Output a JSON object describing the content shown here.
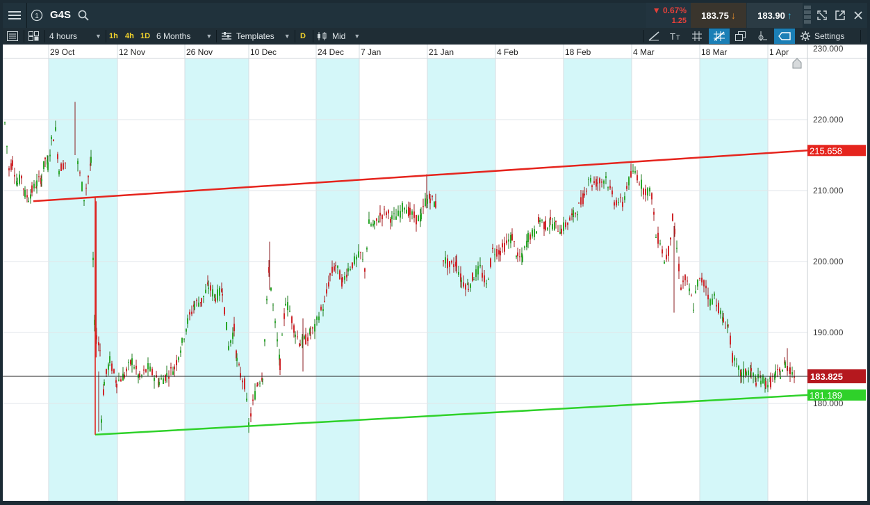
{
  "header": {
    "symbol": "G4S",
    "change_percent": "▼ 0.67%",
    "change_abs": "1.25",
    "sell_price": "183.75",
    "buy_price": "183.90",
    "icons": [
      "menu-icon",
      "info-icon",
      "search-icon",
      "chart-icon",
      "expand-icon",
      "popout-icon",
      "close-icon"
    ]
  },
  "toolbar": {
    "interval": "4 hours",
    "quick_intervals": [
      "1h",
      "4h",
      "1D"
    ],
    "range": "6 Months",
    "templates_label": "Templates",
    "d_label": "D",
    "price_type": "Mid",
    "settings_label": "Settings"
  },
  "colors": {
    "up": "#2aa82a",
    "down": "#d0262b",
    "resistance": "#e5241d",
    "support": "#2fd12a",
    "shade": "#d4f7f9",
    "price_tag": "#b5181e"
  },
  "chart_data": {
    "type": "candlestick",
    "symbol": "G4S",
    "interval": "4 hours",
    "range": "6 Months",
    "x_labels": [
      "29 Oct",
      "12 Nov",
      "26 Nov",
      "10 Dec",
      "24 Dec",
      "7 Jan",
      "21 Jan",
      "4 Feb",
      "18 Feb",
      "4 Mar",
      "18 Mar",
      "1 Apr"
    ],
    "y_ticks": [
      "230.000",
      "220.000",
      "210.000",
      "200.000",
      "190.000",
      "180.000"
    ],
    "ylim": [
      174,
      230
    ],
    "current_price": "183.825",
    "current_value": 183.825,
    "resistance_tag": "215.658",
    "resistance_line": [
      {
        "date": "22 Oct",
        "value": 208.5
      },
      {
        "date": "5 Apr",
        "value": 215.658
      }
    ],
    "support_tag": "181.189",
    "support_line": [
      {
        "date": "6 Nov",
        "value": 175.6
      },
      {
        "date": "5 Apr",
        "value": 181.189
      }
    ],
    "path": [
      [
        0,
        219.5
      ],
      [
        6,
        213
      ],
      [
        11,
        214
      ],
      [
        18,
        211
      ],
      [
        24,
        212
      ],
      [
        29,
        209.5
      ],
      [
        34,
        209
      ],
      [
        39,
        210
      ],
      [
        46,
        211
      ],
      [
        53,
        211.8
      ],
      [
        58,
        214.5
      ],
      [
        62,
        213.5
      ],
      [
        67,
        217
      ],
      [
        73,
        218.4
      ],
      [
        78,
        213
      ],
      [
        87,
        214
      ],
      [
        105,
        213.8
      ],
      [
        114,
        209
      ],
      [
        124,
        214
      ],
      [
        129,
        191
      ],
      [
        137,
        187.5
      ],
      [
        139,
        178
      ],
      [
        143,
        183
      ],
      [
        151,
        186
      ],
      [
        161,
        183
      ],
      [
        172,
        184
      ],
      [
        183,
        186
      ],
      [
        194,
        183.5
      ],
      [
        206,
        185
      ],
      [
        222,
        183
      ],
      [
        233,
        184
      ],
      [
        244,
        185
      ],
      [
        255,
        188.5
      ],
      [
        263,
        191.5
      ],
      [
        273,
        194
      ],
      [
        283,
        194.5
      ],
      [
        293,
        196.5
      ],
      [
        303,
        195
      ],
      [
        313,
        196
      ],
      [
        322,
        188
      ],
      [
        330,
        190.5
      ],
      [
        334,
        186
      ],
      [
        339,
        184
      ],
      [
        345,
        182.8
      ],
      [
        351,
        177
      ],
      [
        357,
        180
      ],
      [
        364,
        183
      ],
      [
        371,
        184
      ],
      [
        380,
        199
      ],
      [
        389,
        191
      ],
      [
        396,
        185.5
      ],
      [
        404,
        194.5
      ],
      [
        410,
        193
      ],
      [
        418,
        190
      ],
      [
        425,
        188.5
      ],
      [
        433,
        189
      ],
      [
        440,
        190
      ],
      [
        446,
        190.5
      ],
      [
        452,
        192.5
      ],
      [
        460,
        194
      ],
      [
        468,
        198
      ],
      [
        476,
        199.5
      ],
      [
        486,
        197
      ],
      [
        494,
        199
      ],
      [
        503,
        200
      ],
      [
        512,
        201
      ],
      [
        518,
        199
      ],
      [
        524,
        205.3
      ],
      [
        532,
        205
      ],
      [
        540,
        206.5
      ],
      [
        549,
        207
      ],
      [
        557,
        206
      ],
      [
        566,
        206.5
      ],
      [
        575,
        208
      ],
      [
        583,
        206.8
      ],
      [
        592,
        206
      ],
      [
        599,
        206.2
      ],
      [
        605,
        208.5
      ],
      [
        612,
        209
      ],
      [
        620,
        208
      ],
      [
        631,
        200.5
      ],
      [
        640,
        199.3
      ],
      [
        650,
        199.8
      ],
      [
        657,
        197.3
      ],
      [
        667,
        196.5
      ],
      [
        675,
        198
      ],
      [
        684,
        199
      ],
      [
        693,
        196.5
      ],
      [
        702,
        201.5
      ],
      [
        713,
        201.5
      ],
      [
        722,
        202.5
      ],
      [
        730,
        203.5
      ],
      [
        738,
        200.5
      ],
      [
        745,
        200.5
      ],
      [
        753,
        203.5
      ],
      [
        762,
        204
      ],
      [
        770,
        206
      ],
      [
        778,
        205
      ],
      [
        785,
        205.5
      ],
      [
        793,
        205
      ],
      [
        801,
        204.5
      ],
      [
        810,
        205.5
      ],
      [
        818,
        206.5
      ],
      [
        826,
        207.7
      ],
      [
        834,
        209.3
      ],
      [
        840,
        212
      ],
      [
        845,
        211
      ],
      [
        853,
        211.2
      ],
      [
        859,
        211.3
      ],
      [
        865,
        212
      ],
      [
        871,
        210
      ],
      [
        877,
        208.5
      ],
      [
        883,
        208.5
      ],
      [
        889,
        208
      ],
      [
        895,
        210.6
      ],
      [
        901,
        212
      ],
      [
        907,
        212.7
      ],
      [
        913,
        211.5
      ],
      [
        919,
        210.2
      ],
      [
        925,
        210
      ],
      [
        931,
        209.4
      ],
      [
        937,
        203.5
      ],
      [
        943,
        203
      ],
      [
        949,
        200
      ],
      [
        955,
        201.5
      ],
      [
        961,
        206
      ],
      [
        967,
        201.8
      ],
      [
        973,
        196.5
      ],
      [
        979,
        197.5
      ],
      [
        985,
        195.8
      ],
      [
        991,
        193.7
      ],
      [
        997,
        197
      ],
      [
        1003,
        197.3
      ],
      [
        1009,
        196.5
      ],
      [
        1015,
        194.2
      ],
      [
        1021,
        195.2
      ],
      [
        1027,
        193.5
      ],
      [
        1034,
        191.5
      ],
      [
        1041,
        191
      ],
      [
        1047,
        186.5
      ],
      [
        1053,
        185
      ],
      [
        1060,
        184
      ],
      [
        1067,
        184.5
      ],
      [
        1074,
        184.3
      ],
      [
        1081,
        183.2
      ],
      [
        1088,
        183.5
      ],
      [
        1095,
        182.9
      ],
      [
        1102,
        183
      ],
      [
        1109,
        184
      ],
      [
        1116,
        184.2
      ],
      [
        1123,
        185.5
      ],
      [
        1130,
        184.8
      ],
      [
        1137,
        183.825
      ]
    ]
  }
}
